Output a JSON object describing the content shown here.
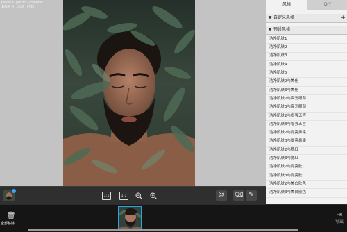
{
  "file_info": {
    "name": "pexels-photo-2589895",
    "meta": "1024 X 1536 (72)"
  },
  "canvas_toolbar": {
    "actual_size_label": "1:1",
    "fit_label": "1:1",
    "zoom_out_icon": "zoom-out-icon",
    "zoom_in_icon": "zoom-in-icon",
    "face_icon": "☺",
    "eraser_icon": "⌫",
    "brush_icon": "✎"
  },
  "right_panel": {
    "tabs": [
      {
        "label": "风格"
      },
      {
        "label": "DIY"
      }
    ],
    "custom_section": {
      "label": "自定义风格",
      "add": "+"
    },
    "preset_section": {
      "label": "预设风格"
    },
    "presets": [
      "洁净肌肤1",
      "洁净肌肤2",
      "洁净肌肤3",
      "洁净肌肤4",
      "洁净肌肤5",
      "洁净肌肤2与美化",
      "洁净肌肤3与美化",
      "洁净肌肤2与高光眼部",
      "洁净肌肤3与高光眼部",
      "洁净肌肤2与增强五官",
      "洁净肌肤3与增强五官",
      "洁净肌肤2与提亮鼻梁",
      "洁净肌肤3与提亮鼻梁",
      "洁净肌肤2与腮红",
      "洁净肌肤3与腮红",
      "洁净肌肤2与提亮肤",
      "洁净肌肤3与提亮肤",
      "洁净肌肤2与美白肤色",
      "洁净肌肤3与美白肤色"
    ]
  },
  "filmstrip": {
    "trash_label": "全部移除",
    "trash_icon": "🗑",
    "export_icon": "⇥",
    "export_label": "导出"
  },
  "colors": {
    "accent": "#2aa5d9",
    "toolbar_bg": "#2f2f2f",
    "canvas_bg": "#c3c3c3",
    "panel_bg": "#f2f2f2"
  }
}
